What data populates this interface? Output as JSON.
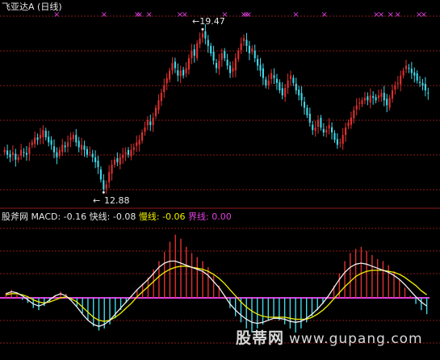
{
  "header": {
    "stock_title": "飞亚达A (日线)"
  },
  "price_panel": {
    "high_marker": "19.47",
    "low_marker": "12.88"
  },
  "indicator_panel": {
    "name": "股斧网",
    "macd_label": "MACD:",
    "macd_value": "-0.16",
    "fast_label": "快线:",
    "fast_value": "-0.08",
    "slow_label": "慢线:",
    "slow_value": "-0.06",
    "zero_label": "界线:",
    "zero_value": "0.00"
  },
  "watermark": {
    "text": "股蒂网",
    "url": "www.gupang.com"
  },
  "colors": {
    "up": "#e03030",
    "down": "#40d8e8",
    "fast_line": "#f0f0f0",
    "slow_line": "#f0f000",
    "zero_line": "#e040e0",
    "marker": "#e040e0",
    "grid": "#8b1a1a"
  },
  "chart_data": [
    {
      "type": "candlestick",
      "title": "飞亚达A (日线)",
      "ylim": [
        12.5,
        20.0
      ],
      "annotations": [
        {
          "label": "19.47",
          "value": 19.47,
          "kind": "high"
        },
        {
          "label": "12.88",
          "value": 12.88,
          "kind": "low"
        }
      ],
      "marker_symbol": "×",
      "marker_positions": [
        22,
        42,
        56,
        57,
        61,
        74,
        76,
        93,
        101,
        102,
        103,
        123,
        135,
        157,
        159,
        163,
        166,
        175,
        177
      ],
      "closes": [
        14.6,
        14.4,
        14.3,
        14.5,
        14.2,
        14.3,
        14.6,
        14.5,
        14.4,
        14.7,
        14.9,
        15.1,
        15.0,
        15.2,
        15.4,
        15.1,
        14.9,
        14.8,
        14.5,
        14.3,
        14.6,
        14.8,
        14.7,
        14.9,
        15.1,
        15.2,
        14.9,
        14.7,
        14.8,
        14.6,
        14.4,
        14.5,
        14.3,
        14.1,
        13.9,
        13.4,
        13.0,
        13.2,
        13.7,
        14.0,
        14.2,
        14.1,
        14.3,
        14.4,
        14.5,
        14.4,
        14.6,
        14.7,
        14.9,
        15.0,
        15.3,
        15.5,
        15.8,
        15.6,
        15.9,
        16.3,
        16.6,
        16.9,
        17.2,
        17.5,
        17.8,
        18.1,
        17.9,
        17.6,
        17.8,
        17.6,
        17.9,
        18.3,
        18.6,
        18.4,
        18.9,
        19.1,
        19.3,
        19.1,
        18.8,
        18.5,
        18.2,
        17.9,
        18.2,
        18.5,
        18.3,
        18.0,
        17.7,
        17.9,
        18.3,
        18.6,
        18.9,
        19.1,
        18.8,
        18.5,
        18.7,
        18.3,
        18.0,
        17.8,
        17.5,
        17.2,
        17.4,
        17.7,
        17.5,
        17.3,
        17.0,
        16.8,
        17.1,
        17.4,
        17.6,
        17.3,
        17.0,
        16.8,
        16.6,
        16.3,
        16.0,
        15.7,
        15.4,
        15.5,
        15.8,
        15.5,
        15.3,
        15.4,
        15.6,
        15.3,
        15.0,
        14.8,
        14.9,
        15.2,
        15.5,
        15.7,
        15.9,
        16.2,
        16.4,
        16.5,
        16.6,
        16.7,
        16.6,
        16.8,
        16.7,
        16.6,
        16.8,
        16.9,
        16.6,
        16.4,
        16.7,
        17.0,
        17.2,
        17.3,
        17.6,
        17.8,
        18.0,
        17.9,
        17.7,
        17.6,
        17.4,
        17.3,
        17.2,
        17.0,
        16.9
      ],
      "y_labels_shown": false
    },
    {
      "type": "line",
      "title": "MACD",
      "series": [
        {
          "name": "MACD",
          "style": "bar",
          "values": [
            0.05,
            0.08,
            0.03,
            -0.02,
            -0.05,
            -0.1,
            -0.12,
            -0.08,
            -0.04,
            0.02,
            0.06,
            0.04,
            -0.02,
            -0.08,
            -0.15,
            -0.22,
            -0.28,
            -0.32,
            -0.3,
            -0.26,
            -0.2,
            -0.12,
            -0.05,
            0.02,
            0.08,
            0.14,
            0.2,
            0.28,
            0.36,
            0.45,
            0.55,
            0.62,
            0.58,
            0.5,
            0.44,
            0.4,
            0.36,
            0.3,
            0.22,
            0.12,
            0.02,
            -0.1,
            -0.18,
            -0.24,
            -0.3,
            -0.34,
            -0.3,
            -0.26,
            -0.22,
            -0.2,
            -0.22,
            -0.26,
            -0.3,
            -0.34,
            -0.3,
            -0.24,
            -0.18,
            -0.12,
            -0.06,
            0.02,
            0.12,
            0.24,
            0.36,
            0.44,
            0.48,
            0.5,
            0.46,
            0.42,
            0.38,
            0.36,
            0.32,
            0.26,
            0.18,
            0.1,
            0.02,
            -0.06,
            -0.12,
            -0.16
          ]
        },
        {
          "name": "快线",
          "values": [
            0.04,
            0.06,
            0.05,
            0.02,
            -0.02,
            -0.06,
            -0.08,
            -0.06,
            -0.02,
            0.02,
            0.04,
            0.02,
            -0.03,
            -0.09,
            -0.16,
            -0.22,
            -0.26,
            -0.28,
            -0.26,
            -0.22,
            -0.16,
            -0.1,
            -0.04,
            0.02,
            0.08,
            0.13,
            0.18,
            0.24,
            0.3,
            0.34,
            0.36,
            0.36,
            0.34,
            0.32,
            0.3,
            0.28,
            0.26,
            0.22,
            0.16,
            0.1,
            0.02,
            -0.06,
            -0.12,
            -0.17,
            -0.21,
            -0.24,
            -0.25,
            -0.24,
            -0.22,
            -0.2,
            -0.2,
            -0.21,
            -0.23,
            -0.24,
            -0.23,
            -0.2,
            -0.16,
            -0.11,
            -0.05,
            0.02,
            0.1,
            0.18,
            0.25,
            0.3,
            0.33,
            0.34,
            0.33,
            0.31,
            0.29,
            0.27,
            0.25,
            0.22,
            0.18,
            0.13,
            0.07,
            0.01,
            -0.04,
            -0.08
          ]
        },
        {
          "name": "慢线",
          "values": [
            0.03,
            0.04,
            0.04,
            0.03,
            0.01,
            -0.02,
            -0.04,
            -0.05,
            -0.04,
            -0.02,
            0.0,
            0.01,
            -0.01,
            -0.04,
            -0.09,
            -0.14,
            -0.19,
            -0.22,
            -0.23,
            -0.22,
            -0.19,
            -0.15,
            -0.1,
            -0.05,
            0.01,
            0.06,
            0.11,
            0.16,
            0.21,
            0.25,
            0.28,
            0.3,
            0.31,
            0.31,
            0.3,
            0.29,
            0.28,
            0.26,
            0.23,
            0.19,
            0.14,
            0.08,
            0.02,
            -0.04,
            -0.09,
            -0.13,
            -0.16,
            -0.18,
            -0.19,
            -0.19,
            -0.19,
            -0.19,
            -0.2,
            -0.21,
            -0.21,
            -0.21,
            -0.19,
            -0.16,
            -0.12,
            -0.07,
            -0.01,
            0.05,
            0.11,
            0.16,
            0.21,
            0.24,
            0.26,
            0.27,
            0.27,
            0.27,
            0.26,
            0.25,
            0.23,
            0.2,
            0.16,
            0.12,
            0.07,
            0.03
          ]
        }
      ],
      "zero_line": 0.0,
      "current": {
        "MACD": -0.16,
        "快线": -0.08,
        "慢线": -0.06,
        "界线": 0.0
      }
    }
  ]
}
